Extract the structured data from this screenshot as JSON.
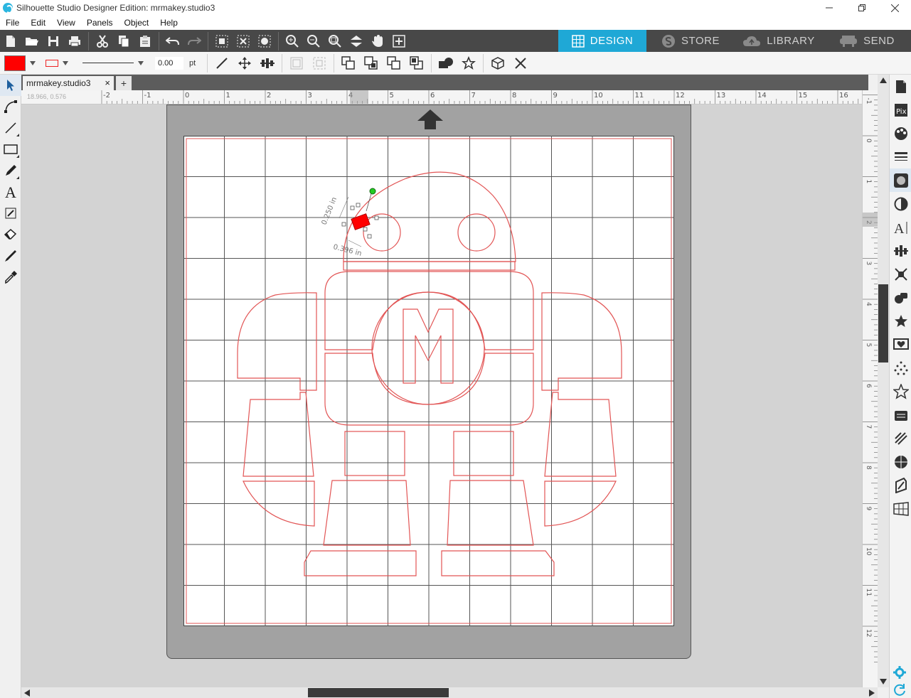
{
  "window": {
    "title": "Silhouette Studio Designer Edition: mrmakey.studio3",
    "controls": [
      "minimize",
      "restore",
      "close"
    ]
  },
  "menu": {
    "items": [
      "File",
      "Edit",
      "View",
      "Panels",
      "Object",
      "Help"
    ]
  },
  "nav_tabs": [
    {
      "label": "DESIGN",
      "icon": "grid-icon",
      "active": true
    },
    {
      "label": "STORE",
      "icon": "silhouette-s-icon",
      "active": false
    },
    {
      "label": "LIBRARY",
      "icon": "cloud-icon",
      "active": false
    },
    {
      "label": "SEND",
      "icon": "cutter-icon",
      "active": false
    }
  ],
  "toolbar": {
    "file_icons": [
      "new-document-icon",
      "open-folder-icon",
      "save-icon",
      "print-icon"
    ],
    "edit_icons": [
      "cut-icon",
      "copy-icon",
      "paste-icon"
    ],
    "history_icons": [
      "undo-icon",
      "redo-icon"
    ],
    "select_icons": [
      "select-all-icon",
      "deselect-icon",
      "edit-points-icon"
    ],
    "zoom_icons": [
      "zoom-in-icon",
      "zoom-out-icon",
      "zoom-select-icon",
      "pan-down-icon",
      "hand-icon",
      "fit-to-page-icon"
    ]
  },
  "quick_bar": {
    "fill_color": "#ff0000",
    "line_color": "#e22222",
    "line_width": "0.00",
    "line_unit": "pt",
    "transform_icons": [
      "line-tool-icon",
      "move-icon",
      "align-icon"
    ],
    "group_icons": [
      "group-icon",
      "ungroup-icon"
    ],
    "arrange_icons": [
      "bring-to-front-icon",
      "send-to-back-icon",
      "bring-forward-icon",
      "send-backward-icon"
    ],
    "modify_icons": [
      "weld-icon",
      "offset-star-icon"
    ],
    "replicate_icons": [
      "replicate-icon",
      "delete-x-icon"
    ]
  },
  "left_tools": [
    "select-arrow-icon",
    "point-edit-icon",
    "line-icon",
    "rectangle-icon",
    "pencil-icon",
    "text-icon",
    "sketch-icon",
    "eraser-icon",
    "knife-icon",
    "eyedropper-icon"
  ],
  "document_tab": {
    "label": "mrmakey.studio3",
    "close": "×",
    "add": "+"
  },
  "ruler": {
    "coord_readout": "18.966, 0.576",
    "h_labels": [
      "-2",
      "-1",
      "0",
      "1",
      "2",
      "3",
      "4",
      "5",
      "6",
      "7",
      "8",
      "9",
      "10",
      "11",
      "12",
      "13",
      "14",
      "15",
      "16"
    ],
    "v_labels": [
      "-1",
      "0",
      "1",
      "2",
      "3",
      "4",
      "5",
      "6",
      "7",
      "8",
      "9",
      "10",
      "11",
      "12"
    ]
  },
  "selection": {
    "height_label": "0.250 in",
    "width_label": "0.396 in",
    "selected_fill": "#ff0000"
  },
  "right_panel": [
    "page-setup-icon",
    "pixscan-icon",
    "fill-color-icon",
    "line-style-icon",
    "image-effects-icon",
    "transparency-icon",
    "text-style-icon",
    "align-panel-icon",
    "offset-panel-icon",
    "modify-panel-icon",
    "star-fill-icon",
    "library-heart-icon",
    "dotted-pattern-icon",
    "star-outline-icon",
    "trace-icon",
    "sketch-fill-icon",
    "replicate-panel-icon",
    "pen-panel-icon",
    "grid-panel-icon"
  ],
  "bottom_right_icons": [
    "settings-gear-icon",
    "refresh-icon"
  ],
  "colors": {
    "toolbar_dark": "#484848",
    "accent_blue": "#1fa8d6",
    "cut_line_red": "#e05050",
    "mat_gray": "#a2a2a2"
  }
}
